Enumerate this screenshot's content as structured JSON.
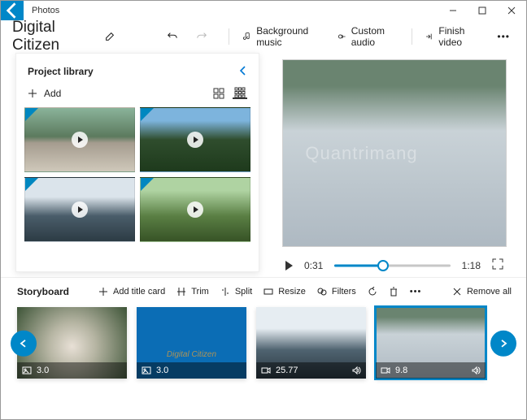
{
  "window": {
    "app_title": "Photos"
  },
  "project": {
    "name": "Digital Citizen"
  },
  "toolbar": {
    "bg_music": "Background music",
    "custom_audio": "Custom audio",
    "finish": "Finish video"
  },
  "library": {
    "title": "Project library",
    "add_label": "Add"
  },
  "player": {
    "current": "0:31",
    "total": "1:18"
  },
  "storyboard": {
    "title": "Storyboard",
    "add_title_card": "Add title card",
    "trim": "Trim",
    "split": "Split",
    "resize": "Resize",
    "filters": "Filters",
    "remove_all": "Remove all"
  },
  "clips": [
    {
      "duration": "3.0",
      "kind": "image",
      "has_audio": false
    },
    {
      "duration": "3.0",
      "kind": "image",
      "has_audio": false,
      "caption": "Digital Citizen"
    },
    {
      "duration": "25.77",
      "kind": "video",
      "has_audio": true
    },
    {
      "duration": "9.8",
      "kind": "video",
      "has_audio": true
    }
  ],
  "watermark": "Quantrimang"
}
